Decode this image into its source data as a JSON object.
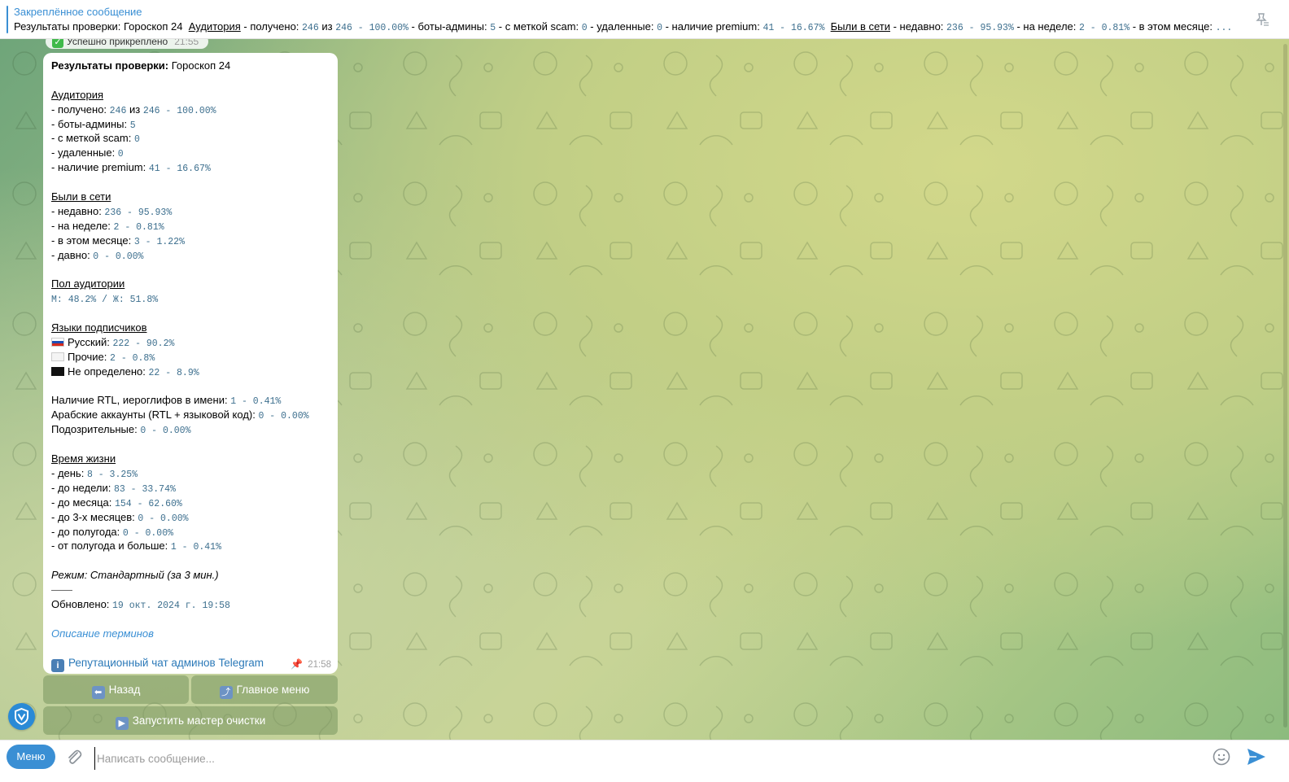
{
  "pinned": {
    "title": "Закреплённое сообщение",
    "preview_prefix": "Результаты проверки: Гороскоп 24",
    "preview_audience_label": "Аудитория",
    "preview_audience_text": " - получено: ",
    "preview_received": "246",
    "preview_of": " из ",
    "preview_total": "246 - 100.00%",
    "preview_bots_label": " - боты-админы: ",
    "preview_bots": "5",
    "preview_scam_label": " - с меткой scam: ",
    "preview_scam": "0",
    "preview_deleted_label": " - удаленные: ",
    "preview_deleted": "0",
    "preview_premium_label": " - наличие premium: ",
    "preview_premium": "41 - 16.67%",
    "preview_online_label": "Были в сети",
    "preview_recent_label": " - недавно: ",
    "preview_recent": "236 - 95.93%",
    "preview_week_label": " - на неделе: ",
    "preview_week": "2 - 0.81%",
    "preview_month_label": " - в этом месяце: ",
    "preview_ellipsis": "..."
  },
  "service": {
    "text": "Успешно прикреплено",
    "time": "21:55"
  },
  "message": {
    "header_bold": "Результаты проверки:",
    "header_name": " Гороскоп 24",
    "audience": {
      "title": "Аудитория",
      "received_label": "- получено: ",
      "received": "246",
      "of": " из ",
      "total": "246 - 100.00%",
      "bots_label": "- боты-админы: ",
      "bots": "5",
      "scam_label": "- с меткой scam: ",
      "scam": "0",
      "deleted_label": "- удаленные: ",
      "deleted": "0",
      "premium_label": "- наличие premium: ",
      "premium": "41 - 16.67%"
    },
    "online": {
      "title": "Были в сети",
      "recent_label": "- недавно: ",
      "recent": "236 - 95.93%",
      "week_label": "- на неделе: ",
      "week": "2 - 0.81%",
      "month_label": "- в этом месяце: ",
      "month": "3 - 1.22%",
      "long_label": "- давно: ",
      "long": "0 - 0.00%"
    },
    "gender": {
      "title": "Пол аудитории",
      "value": "М: 48.2% / Ж: 51.8%"
    },
    "languages": {
      "title": "Языки подписчиков",
      "ru_label": "Русский: ",
      "ru": "222 - 90.2%",
      "other_label": "Прочие: ",
      "other": "2 - 0.8%",
      "undef_label": "Не определено: ",
      "undef": "22 - 8.9%"
    },
    "rtl_label": "Наличие RTL, иероглифов в имени: ",
    "rtl": "1 - 0.41%",
    "arab_label": "Арабские аккаунты (RTL + языковой код): ",
    "arab": "0 - 0.00%",
    "susp_label": "Подозрительные: ",
    "susp": "0 - 0.00%",
    "lifetime": {
      "title": "Время жизни",
      "day_label": "- день: ",
      "day": "8 - 3.25%",
      "week_label": "- до недели: ",
      "week": "83 - 33.74%",
      "month_label": "- до месяца: ",
      "month": "154 - 62.60%",
      "m3_label": "- до 3-х месяцев: ",
      "m3": "0 - 0.00%",
      "half_label": "- до полугода: ",
      "half": "0 - 0.00%",
      "more_label": "- от полугода и больше: ",
      "more": "1 - 0.41%"
    },
    "mode": "Режим: Стандартный (за 3 мин.)",
    "separator": "——",
    "updated_label": "Обновлено: ",
    "updated": "19 окт. 2024 г. 19:58",
    "terms_link": "Описание терминов",
    "reputation_link": "Репутационный чат админов Telegram",
    "time": "21:58"
  },
  "keyboard": {
    "back": "Назад",
    "main_menu": "Главное меню",
    "cleanup": "Запустить мастер очистки"
  },
  "input": {
    "menu_label": "Меню",
    "placeholder": "Написать сообщение..."
  },
  "colors": {
    "accent": "#3a8fd4",
    "mono_value": "#3d6f8e"
  }
}
